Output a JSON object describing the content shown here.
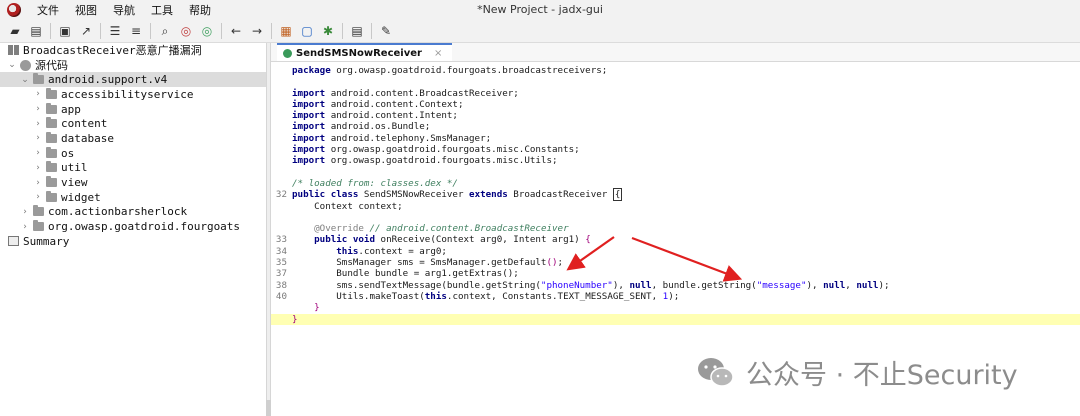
{
  "window": {
    "title": "*New Project - jadx-gui"
  },
  "menu": [
    "文件",
    "视图",
    "导航",
    "工具",
    "帮助"
  ],
  "toolbar_icons": [
    "folder-open-icon",
    "add-files-icon",
    "save-icon",
    "export-icon",
    "sync-icon",
    "flatten-icon",
    "search-icon",
    "find-class-icon",
    "find-usage-icon",
    "back-icon",
    "forward-icon",
    "deobfuscate-icon",
    "quark-icon",
    "log-icon",
    "debug-icon",
    "settings-icon"
  ],
  "tree": {
    "root": "BroadcastReceiver恶意广播漏洞",
    "source": "源代码",
    "selected_package": "android.support.v4",
    "subpackages": [
      "accessibilityservice",
      "app",
      "content",
      "database",
      "os",
      "util",
      "view",
      "widget"
    ],
    "other_packages": [
      "com.actionbarsherlock",
      "org.owasp.goatdroid.fourgoats"
    ],
    "summary": "Summary"
  },
  "editor": {
    "tab_label": "SendSMSNowReceiver",
    "tab_close": "×",
    "lines": [
      {
        "ln": "",
        "html": "<span class='kw'>package</span> org.owasp.goatdroid.fourgoats.broadcastreceivers;"
      },
      {
        "ln": "",
        "html": ""
      },
      {
        "ln": "",
        "html": "<span class='kw'>import</span> android.content.BroadcastReceiver;"
      },
      {
        "ln": "",
        "html": "<span class='kw'>import</span> android.content.Context;"
      },
      {
        "ln": "",
        "html": "<span class='kw'>import</span> android.content.Intent;"
      },
      {
        "ln": "",
        "html": "<span class='kw'>import</span> android.os.Bundle;"
      },
      {
        "ln": "",
        "html": "<span class='kw'>import</span> android.telephony.SmsManager;"
      },
      {
        "ln": "",
        "html": "<span class='kw'>import</span> org.owasp.goatdroid.fourgoats.misc.Constants;"
      },
      {
        "ln": "",
        "html": "<span class='kw'>import</span> org.owasp.goatdroid.fourgoats.misc.Utils;"
      },
      {
        "ln": "",
        "html": ""
      },
      {
        "ln": "",
        "html": "<span class='cm'>/* loaded from: classes.dex */</span>"
      },
      {
        "ln": "32",
        "html": "<span class='kw'>public class</span> SendSMSNowReceiver <span class='kw'>extends</span> BroadcastReceiver <span class='box'>{</span>"
      },
      {
        "ln": "",
        "html": "    Context context;"
      },
      {
        "ln": "",
        "html": ""
      },
      {
        "ln": "",
        "html": "    <span class='an'>@Override</span> <span class='cm'>// android.content.BroadcastReceiver</span>"
      },
      {
        "ln": "33",
        "html": "    <span class='kw'>public void</span> onReceive(Context arg0, Intent arg1) <span class='brace'>{</span>"
      },
      {
        "ln": "34",
        "html": "        <span class='kw'>this</span>.context = arg0;"
      },
      {
        "ln": "35",
        "html": "        SmsManager sms = SmsManager.getDefault<span class='brace'>()</span>;"
      },
      {
        "ln": "37",
        "html": "        Bundle bundle = arg1.getExtras();"
      },
      {
        "ln": "38",
        "html": "        sms.sendTextMessage(bundle.getString(<span class='str'>\"phoneNumber\"</span>), <span class='kw'>null</span>, bundle.getString(<span class='str'>\"message\"</span>), <span class='kw'>null</span>, <span class='kw'>null</span>);"
      },
      {
        "ln": "40",
        "html": "        Utils.makeToast(<span class='kw'>this</span>.context, Constants.TEXT_MESSAGE_SENT, <span class='num'>1</span>);"
      },
      {
        "ln": "",
        "html": "    <span class='brace'>}</span>"
      },
      {
        "ln": "",
        "html": "<span class='brace'>}</span>",
        "highlight": true
      }
    ]
  },
  "watermark": {
    "text": "公众号 · 不止Security"
  }
}
